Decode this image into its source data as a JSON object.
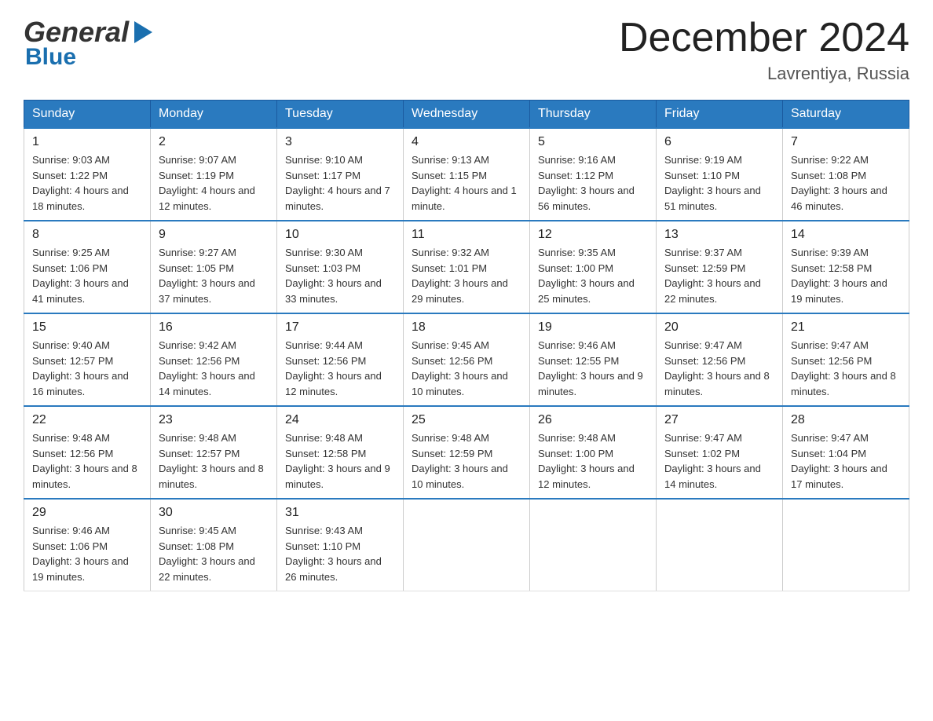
{
  "header": {
    "logo_line1": "General",
    "logo_line2": "Blue",
    "month_title": "December 2024",
    "location": "Lavrentiya, Russia"
  },
  "days_of_week": [
    "Sunday",
    "Monday",
    "Tuesday",
    "Wednesday",
    "Thursday",
    "Friday",
    "Saturday"
  ],
  "weeks": [
    [
      {
        "day": "1",
        "sunrise": "9:03 AM",
        "sunset": "1:22 PM",
        "daylight": "4 hours and 18 minutes."
      },
      {
        "day": "2",
        "sunrise": "9:07 AM",
        "sunset": "1:19 PM",
        "daylight": "4 hours and 12 minutes."
      },
      {
        "day": "3",
        "sunrise": "9:10 AM",
        "sunset": "1:17 PM",
        "daylight": "4 hours and 7 minutes."
      },
      {
        "day": "4",
        "sunrise": "9:13 AM",
        "sunset": "1:15 PM",
        "daylight": "4 hours and 1 minute."
      },
      {
        "day": "5",
        "sunrise": "9:16 AM",
        "sunset": "1:12 PM",
        "daylight": "3 hours and 56 minutes."
      },
      {
        "day": "6",
        "sunrise": "9:19 AM",
        "sunset": "1:10 PM",
        "daylight": "3 hours and 51 minutes."
      },
      {
        "day": "7",
        "sunrise": "9:22 AM",
        "sunset": "1:08 PM",
        "daylight": "3 hours and 46 minutes."
      }
    ],
    [
      {
        "day": "8",
        "sunrise": "9:25 AM",
        "sunset": "1:06 PM",
        "daylight": "3 hours and 41 minutes."
      },
      {
        "day": "9",
        "sunrise": "9:27 AM",
        "sunset": "1:05 PM",
        "daylight": "3 hours and 37 minutes."
      },
      {
        "day": "10",
        "sunrise": "9:30 AM",
        "sunset": "1:03 PM",
        "daylight": "3 hours and 33 minutes."
      },
      {
        "day": "11",
        "sunrise": "9:32 AM",
        "sunset": "1:01 PM",
        "daylight": "3 hours and 29 minutes."
      },
      {
        "day": "12",
        "sunrise": "9:35 AM",
        "sunset": "1:00 PM",
        "daylight": "3 hours and 25 minutes."
      },
      {
        "day": "13",
        "sunrise": "9:37 AM",
        "sunset": "12:59 PM",
        "daylight": "3 hours and 22 minutes."
      },
      {
        "day": "14",
        "sunrise": "9:39 AM",
        "sunset": "12:58 PM",
        "daylight": "3 hours and 19 minutes."
      }
    ],
    [
      {
        "day": "15",
        "sunrise": "9:40 AM",
        "sunset": "12:57 PM",
        "daylight": "3 hours and 16 minutes."
      },
      {
        "day": "16",
        "sunrise": "9:42 AM",
        "sunset": "12:56 PM",
        "daylight": "3 hours and 14 minutes."
      },
      {
        "day": "17",
        "sunrise": "9:44 AM",
        "sunset": "12:56 PM",
        "daylight": "3 hours and 12 minutes."
      },
      {
        "day": "18",
        "sunrise": "9:45 AM",
        "sunset": "12:56 PM",
        "daylight": "3 hours and 10 minutes."
      },
      {
        "day": "19",
        "sunrise": "9:46 AM",
        "sunset": "12:55 PM",
        "daylight": "3 hours and 9 minutes."
      },
      {
        "day": "20",
        "sunrise": "9:47 AM",
        "sunset": "12:56 PM",
        "daylight": "3 hours and 8 minutes."
      },
      {
        "day": "21",
        "sunrise": "9:47 AM",
        "sunset": "12:56 PM",
        "daylight": "3 hours and 8 minutes."
      }
    ],
    [
      {
        "day": "22",
        "sunrise": "9:48 AM",
        "sunset": "12:56 PM",
        "daylight": "3 hours and 8 minutes."
      },
      {
        "day": "23",
        "sunrise": "9:48 AM",
        "sunset": "12:57 PM",
        "daylight": "3 hours and 8 minutes."
      },
      {
        "day": "24",
        "sunrise": "9:48 AM",
        "sunset": "12:58 PM",
        "daylight": "3 hours and 9 minutes."
      },
      {
        "day": "25",
        "sunrise": "9:48 AM",
        "sunset": "12:59 PM",
        "daylight": "3 hours and 10 minutes."
      },
      {
        "day": "26",
        "sunrise": "9:48 AM",
        "sunset": "1:00 PM",
        "daylight": "3 hours and 12 minutes."
      },
      {
        "day": "27",
        "sunrise": "9:47 AM",
        "sunset": "1:02 PM",
        "daylight": "3 hours and 14 minutes."
      },
      {
        "day": "28",
        "sunrise": "9:47 AM",
        "sunset": "1:04 PM",
        "daylight": "3 hours and 17 minutes."
      }
    ],
    [
      {
        "day": "29",
        "sunrise": "9:46 AM",
        "sunset": "1:06 PM",
        "daylight": "3 hours and 19 minutes."
      },
      {
        "day": "30",
        "sunrise": "9:45 AM",
        "sunset": "1:08 PM",
        "daylight": "3 hours and 22 minutes."
      },
      {
        "day": "31",
        "sunrise": "9:43 AM",
        "sunset": "1:10 PM",
        "daylight": "3 hours and 26 minutes."
      },
      null,
      null,
      null,
      null
    ]
  ]
}
